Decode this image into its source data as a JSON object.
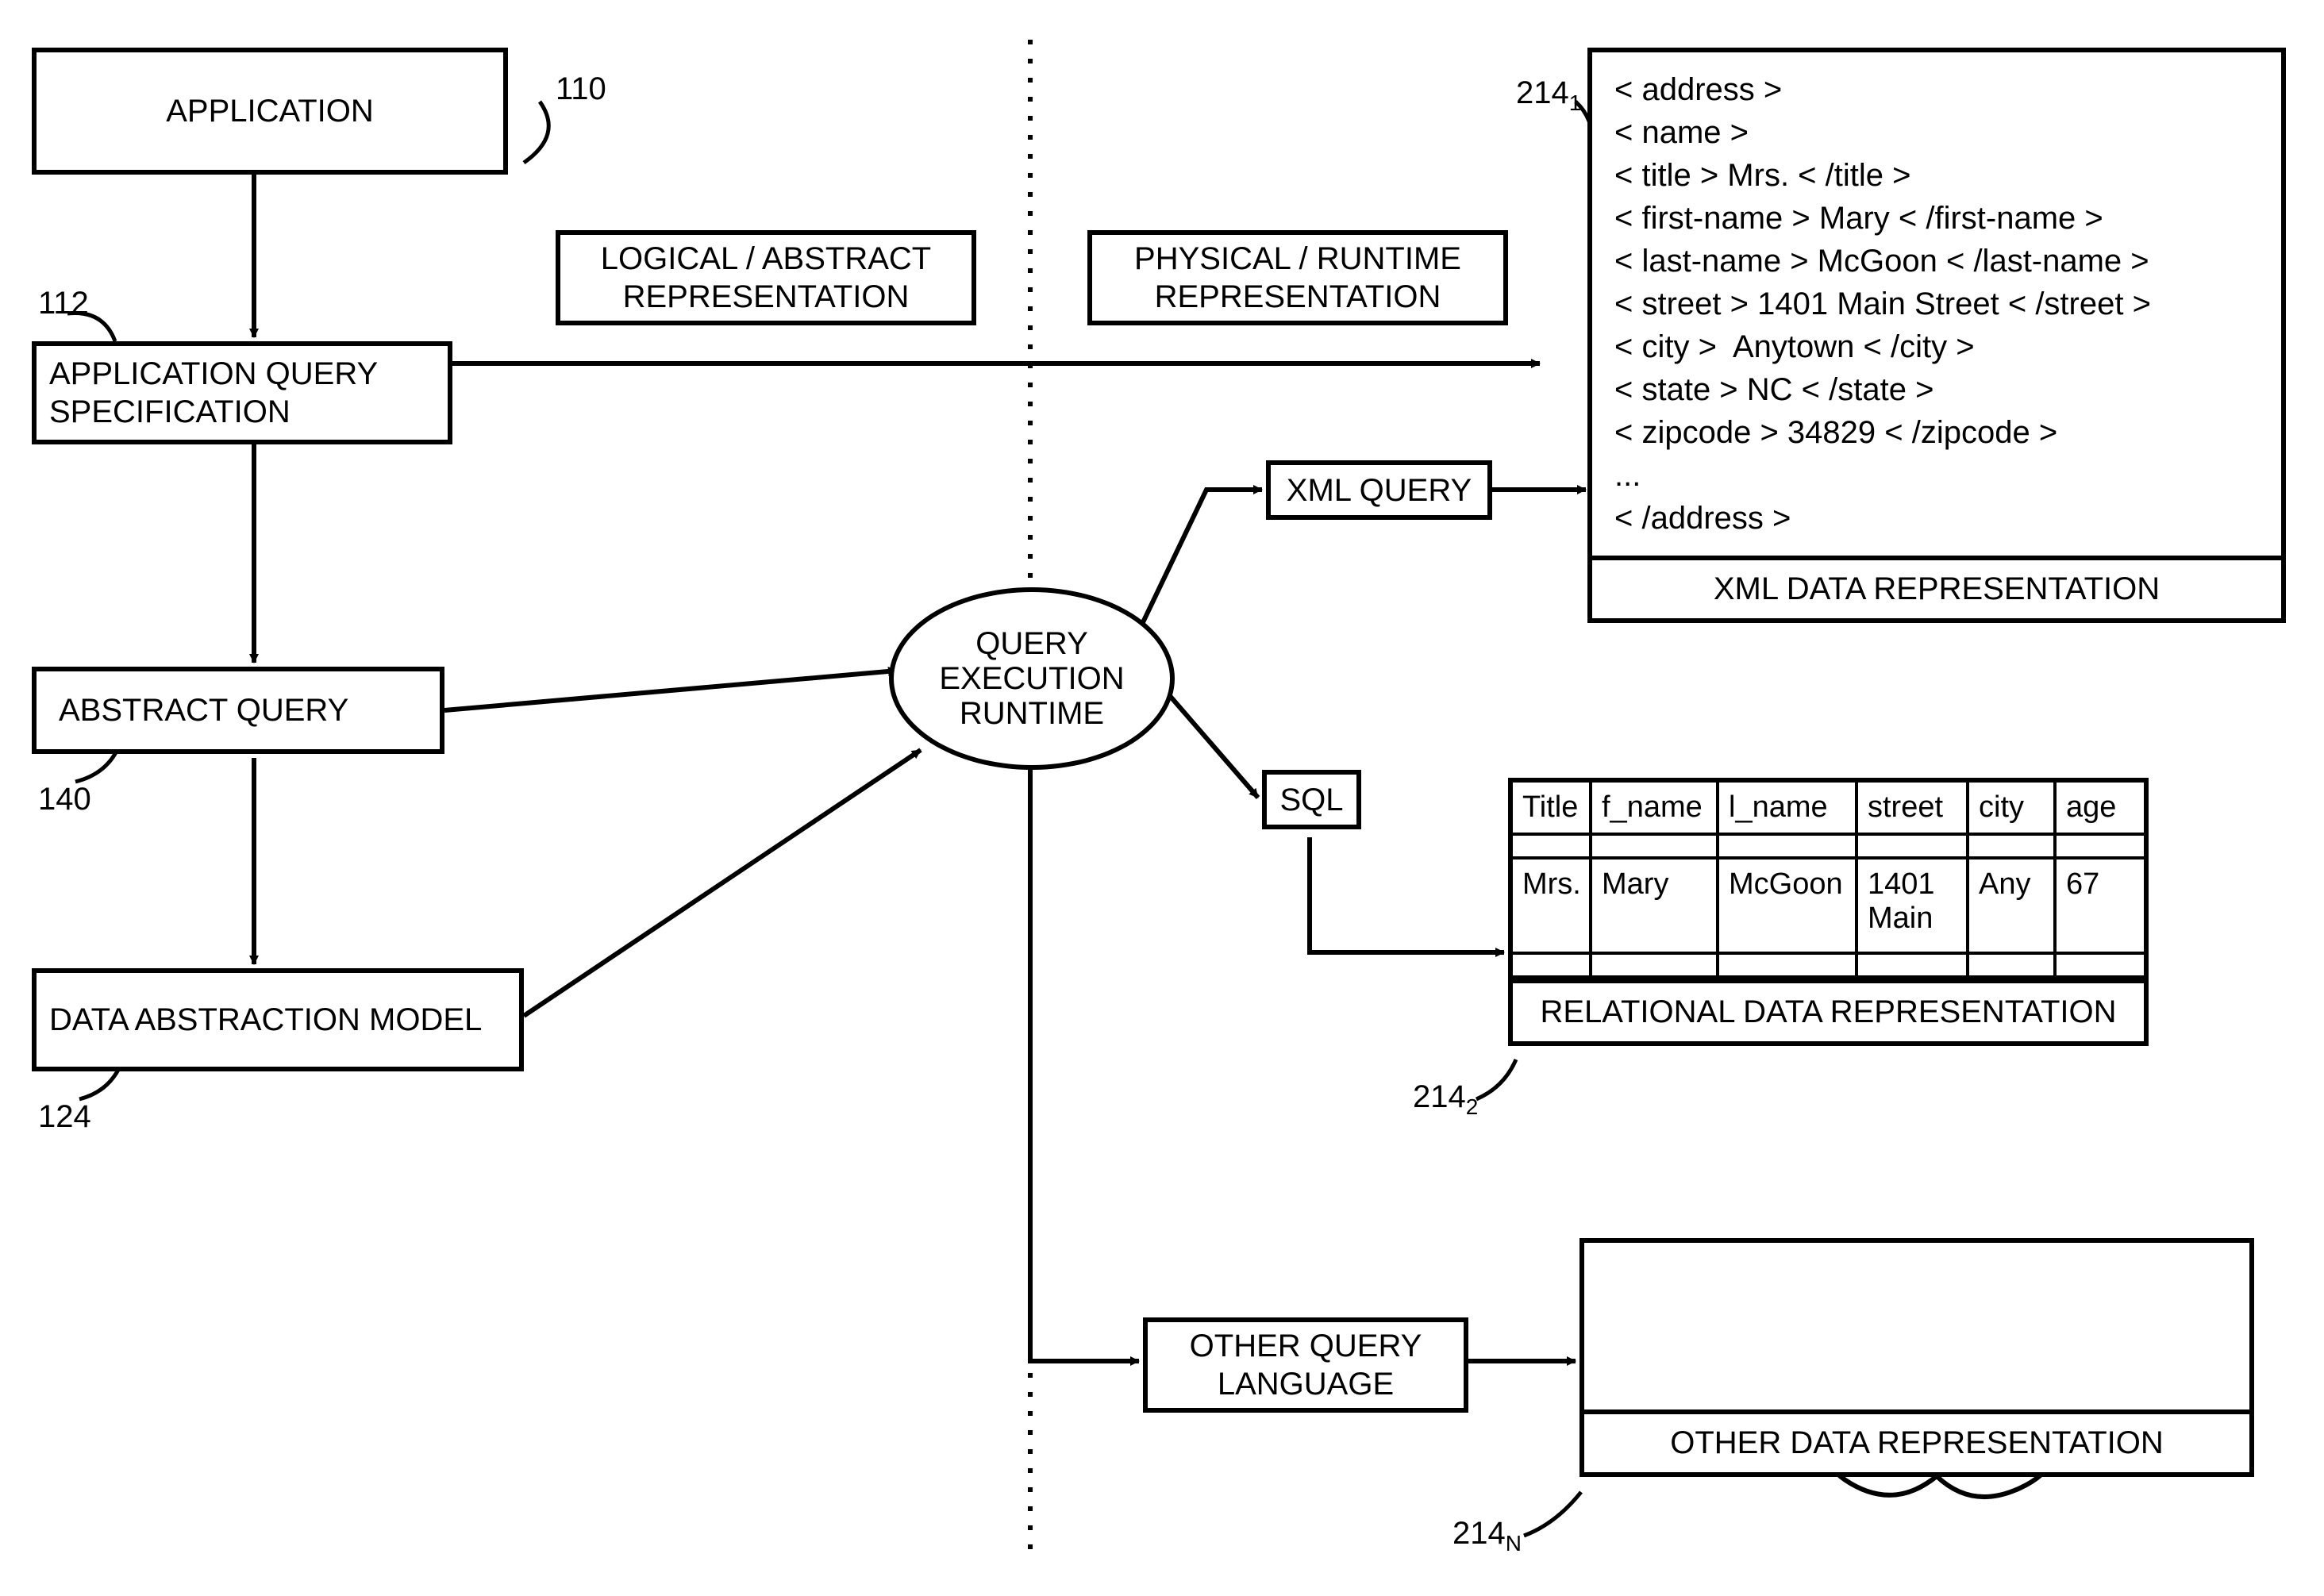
{
  "refs": {
    "r110": "110",
    "r112": "112",
    "r140": "140",
    "r124": "124",
    "r214_1": "214",
    "r214_1_sub": "1",
    "r214_2": "214",
    "r214_2_sub": "2",
    "r214_N": "214",
    "r214_N_sub": "N"
  },
  "boxes": {
    "application": "APPLICATION",
    "app_query_spec": "APPLICATION QUERY SPECIFICATION",
    "abstract_query": "ABSTRACT QUERY",
    "data_abstraction_model": "DATA ABSTRACTION MODEL",
    "logical_abstract": "LOGICAL / ABSTRACT REPRESENTATION",
    "physical_runtime": "PHYSICAL / RUNTIME REPRESENTATION",
    "query_exec_runtime": "QUERY EXECUTION RUNTIME",
    "xml_query": "XML QUERY",
    "sql": "SQL",
    "other_query_lang": "OTHER QUERY LANGUAGE",
    "xml_footer": "XML DATA REPRESENTATION",
    "rel_footer": "RELATIONAL DATA REPRESENTATION",
    "other_footer": "OTHER DATA REPRESENTATION"
  },
  "xml_lines": [
    "< address >",
    "< name >",
    "< title > Mrs. < /title >",
    "< first-name > Mary < /first-name >",
    "< last-name > McGoon < /last-name >",
    "< street > 1401 Main Street < /street >",
    "< city >  Anytown < /city >",
    "< state > NC < /state >",
    "< zipcode > 34829 < /zipcode >",
    "...",
    "< /address >"
  ],
  "table": {
    "headers": [
      "Title",
      "f_name",
      "l_name",
      "street",
      "city",
      "age"
    ],
    "row": [
      "Mrs.",
      "Mary",
      "McGoon",
      "1401 Main",
      "Any",
      "67"
    ]
  }
}
